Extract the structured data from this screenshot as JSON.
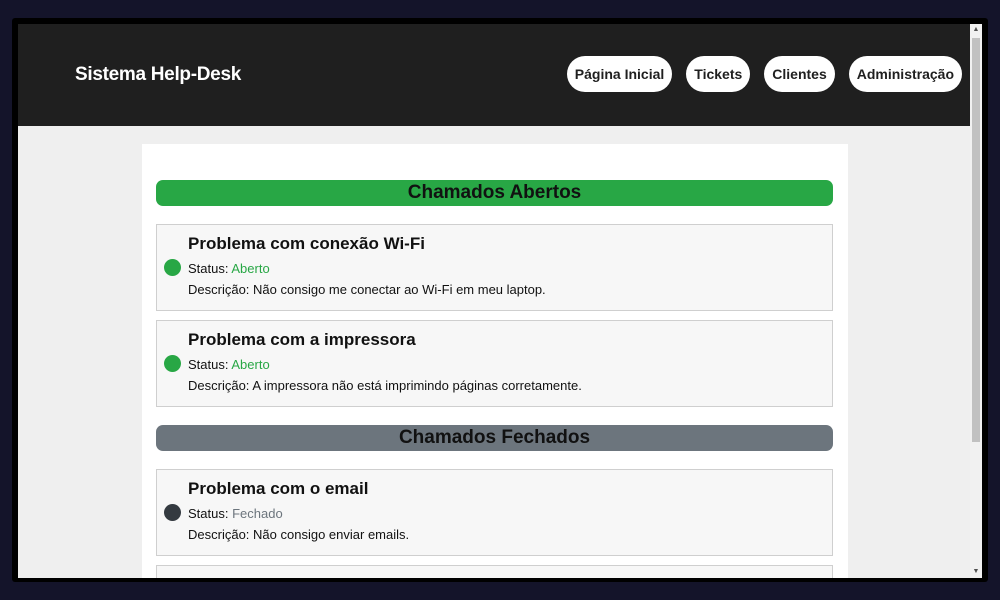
{
  "app": {
    "title": "Sistema Help-Desk"
  },
  "nav": {
    "items": [
      {
        "label": "Página Inicial"
      },
      {
        "label": "Tickets"
      },
      {
        "label": "Clientes"
      },
      {
        "label": "Administração"
      }
    ]
  },
  "sections": {
    "open": {
      "title": "Chamados Abertos",
      "tickets": [
        {
          "title": "Problema com conexão Wi-Fi",
          "status_label": "Status:",
          "status_value": "Aberto",
          "desc_label": "Descrição:",
          "description": "Não consigo me conectar ao Wi-Fi em meu laptop."
        },
        {
          "title": "Problema com a impressora",
          "status_label": "Status:",
          "status_value": "Aberto",
          "desc_label": "Descrição:",
          "description": "A impressora não está imprimindo páginas corretamente."
        }
      ]
    },
    "closed": {
      "title": "Chamados Fechados",
      "tickets": [
        {
          "title": "Problema com o email",
          "status_label": "Status:",
          "status_value": "Fechado",
          "desc_label": "Descrição:",
          "description": "Não consigo enviar emails."
        }
      ]
    }
  },
  "colors": {
    "header_bg": "#1f1f1f",
    "open": "#28a745",
    "closed": "#6c757d",
    "closed_dot": "#343a40"
  },
  "icons": {
    "scroll_up": "scroll-up-arrow-icon",
    "scroll_down": "scroll-down-arrow-icon",
    "status_dot": "status-dot-icon"
  }
}
